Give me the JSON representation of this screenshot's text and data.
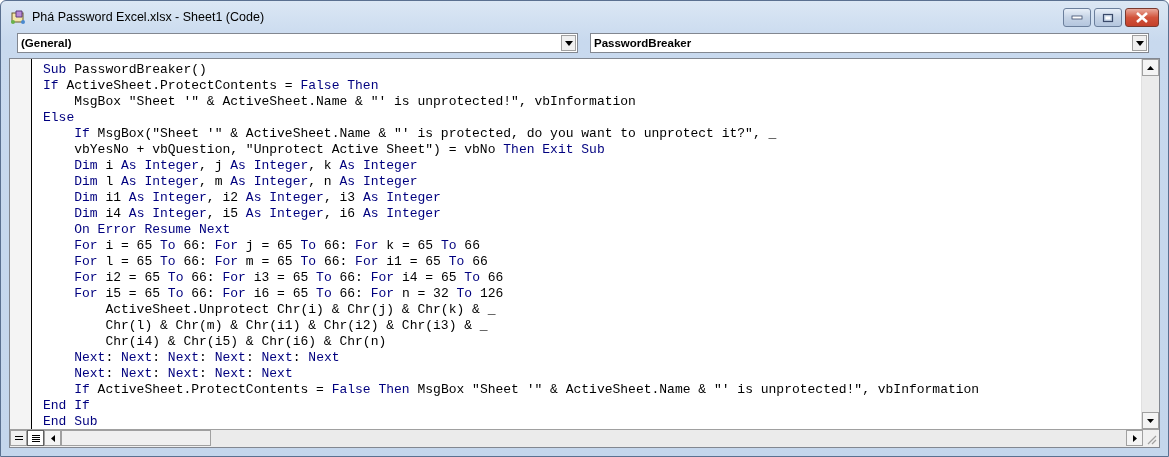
{
  "window": {
    "title": "Phá Password Excel.xlsx - Sheet1 (Code)"
  },
  "object_dropdown": {
    "value": "(General)"
  },
  "procedure_dropdown": {
    "value": "PasswordBreaker"
  },
  "code_lines": [
    {
      "tokens": [
        {
          "kind": "keyword",
          "text": "Sub"
        },
        {
          "kind": "plain",
          "text": " PasswordBreaker()"
        }
      ]
    },
    {
      "tokens": [
        {
          "kind": "keyword",
          "text": "If"
        },
        {
          "kind": "plain",
          "text": " ActiveSheet.ProtectContents = "
        },
        {
          "kind": "keyword",
          "text": "False Then"
        }
      ]
    },
    {
      "tokens": [
        {
          "kind": "plain",
          "text": "    MsgBox \"Sheet '\" & ActiveSheet.Name & \"' is unprotected!\", vbInformation"
        }
      ]
    },
    {
      "tokens": [
        {
          "kind": "keyword",
          "text": "Else"
        }
      ]
    },
    {
      "tokens": [
        {
          "kind": "keyword",
          "text": "    If"
        },
        {
          "kind": "plain",
          "text": " MsgBox(\"Sheet '\" & ActiveSheet.Name & \"' is protected, do you want to unprotect it?\", _"
        }
      ]
    },
    {
      "tokens": [
        {
          "kind": "plain",
          "text": "    vbYesNo + vbQuestion, \"Unprotect Active Sheet\") = vbNo "
        },
        {
          "kind": "keyword",
          "text": "Then Exit Sub"
        }
      ]
    },
    {
      "tokens": [
        {
          "kind": "keyword",
          "text": "    Dim"
        },
        {
          "kind": "plain",
          "text": " i "
        },
        {
          "kind": "keyword",
          "text": "As Integer"
        },
        {
          "kind": "plain",
          "text": ", j "
        },
        {
          "kind": "keyword",
          "text": "As Integer"
        },
        {
          "kind": "plain",
          "text": ", k "
        },
        {
          "kind": "keyword",
          "text": "As Integer"
        }
      ]
    },
    {
      "tokens": [
        {
          "kind": "keyword",
          "text": "    Dim"
        },
        {
          "kind": "plain",
          "text": " l "
        },
        {
          "kind": "keyword",
          "text": "As Integer"
        },
        {
          "kind": "plain",
          "text": ", m "
        },
        {
          "kind": "keyword",
          "text": "As Integer"
        },
        {
          "kind": "plain",
          "text": ", n "
        },
        {
          "kind": "keyword",
          "text": "As Integer"
        }
      ]
    },
    {
      "tokens": [
        {
          "kind": "keyword",
          "text": "    Dim"
        },
        {
          "kind": "plain",
          "text": " i1 "
        },
        {
          "kind": "keyword",
          "text": "As Integer"
        },
        {
          "kind": "plain",
          "text": ", i2 "
        },
        {
          "kind": "keyword",
          "text": "As Integer"
        },
        {
          "kind": "plain",
          "text": ", i3 "
        },
        {
          "kind": "keyword",
          "text": "As Integer"
        }
      ]
    },
    {
      "tokens": [
        {
          "kind": "keyword",
          "text": "    Dim"
        },
        {
          "kind": "plain",
          "text": " i4 "
        },
        {
          "kind": "keyword",
          "text": "As Integer"
        },
        {
          "kind": "plain",
          "text": ", i5 "
        },
        {
          "kind": "keyword",
          "text": "As Integer"
        },
        {
          "kind": "plain",
          "text": ", i6 "
        },
        {
          "kind": "keyword",
          "text": "As Integer"
        }
      ]
    },
    {
      "tokens": [
        {
          "kind": "keyword",
          "text": "    On Error Resume Next"
        }
      ]
    },
    {
      "tokens": [
        {
          "kind": "keyword",
          "text": "    For"
        },
        {
          "kind": "plain",
          "text": " i = 65 "
        },
        {
          "kind": "keyword",
          "text": "To"
        },
        {
          "kind": "plain",
          "text": " 66: "
        },
        {
          "kind": "keyword",
          "text": "For"
        },
        {
          "kind": "plain",
          "text": " j = 65 "
        },
        {
          "kind": "keyword",
          "text": "To"
        },
        {
          "kind": "plain",
          "text": " 66: "
        },
        {
          "kind": "keyword",
          "text": "For"
        },
        {
          "kind": "plain",
          "text": " k = 65 "
        },
        {
          "kind": "keyword",
          "text": "To"
        },
        {
          "kind": "plain",
          "text": " 66"
        }
      ]
    },
    {
      "tokens": [
        {
          "kind": "keyword",
          "text": "    For"
        },
        {
          "kind": "plain",
          "text": " l = 65 "
        },
        {
          "kind": "keyword",
          "text": "To"
        },
        {
          "kind": "plain",
          "text": " 66: "
        },
        {
          "kind": "keyword",
          "text": "For"
        },
        {
          "kind": "plain",
          "text": " m = 65 "
        },
        {
          "kind": "keyword",
          "text": "To"
        },
        {
          "kind": "plain",
          "text": " 66: "
        },
        {
          "kind": "keyword",
          "text": "For"
        },
        {
          "kind": "plain",
          "text": " i1 = 65 "
        },
        {
          "kind": "keyword",
          "text": "To"
        },
        {
          "kind": "plain",
          "text": " 66"
        }
      ]
    },
    {
      "tokens": [
        {
          "kind": "keyword",
          "text": "    For"
        },
        {
          "kind": "plain",
          "text": " i2 = 65 "
        },
        {
          "kind": "keyword",
          "text": "To"
        },
        {
          "kind": "plain",
          "text": " 66: "
        },
        {
          "kind": "keyword",
          "text": "For"
        },
        {
          "kind": "plain",
          "text": " i3 = 65 "
        },
        {
          "kind": "keyword",
          "text": "To"
        },
        {
          "kind": "plain",
          "text": " 66: "
        },
        {
          "kind": "keyword",
          "text": "For"
        },
        {
          "kind": "plain",
          "text": " i4 = 65 "
        },
        {
          "kind": "keyword",
          "text": "To"
        },
        {
          "kind": "plain",
          "text": " 66"
        }
      ]
    },
    {
      "tokens": [
        {
          "kind": "keyword",
          "text": "    For"
        },
        {
          "kind": "plain",
          "text": " i5 = 65 "
        },
        {
          "kind": "keyword",
          "text": "To"
        },
        {
          "kind": "plain",
          "text": " 66: "
        },
        {
          "kind": "keyword",
          "text": "For"
        },
        {
          "kind": "plain",
          "text": " i6 = 65 "
        },
        {
          "kind": "keyword",
          "text": "To"
        },
        {
          "kind": "plain",
          "text": " 66: "
        },
        {
          "kind": "keyword",
          "text": "For"
        },
        {
          "kind": "plain",
          "text": " n = 32 "
        },
        {
          "kind": "keyword",
          "text": "To"
        },
        {
          "kind": "plain",
          "text": " 126"
        }
      ]
    },
    {
      "tokens": [
        {
          "kind": "plain",
          "text": "        ActiveSheet.Unprotect Chr(i) & Chr(j) & Chr(k) & _"
        }
      ]
    },
    {
      "tokens": [
        {
          "kind": "plain",
          "text": "        Chr(l) & Chr(m) & Chr(i1) & Chr(i2) & Chr(i3) & _"
        }
      ]
    },
    {
      "tokens": [
        {
          "kind": "plain",
          "text": "        Chr(i4) & Chr(i5) & Chr(i6) & Chr(n)"
        }
      ]
    },
    {
      "tokens": [
        {
          "kind": "keyword",
          "text": "    Next"
        },
        {
          "kind": "plain",
          "text": ": "
        },
        {
          "kind": "keyword",
          "text": "Next"
        },
        {
          "kind": "plain",
          "text": ": "
        },
        {
          "kind": "keyword",
          "text": "Next"
        },
        {
          "kind": "plain",
          "text": ": "
        },
        {
          "kind": "keyword",
          "text": "Next"
        },
        {
          "kind": "plain",
          "text": ": "
        },
        {
          "kind": "keyword",
          "text": "Next"
        },
        {
          "kind": "plain",
          "text": ": "
        },
        {
          "kind": "keyword",
          "text": "Next"
        }
      ]
    },
    {
      "tokens": [
        {
          "kind": "keyword",
          "text": "    Next"
        },
        {
          "kind": "plain",
          "text": ": "
        },
        {
          "kind": "keyword",
          "text": "Next"
        },
        {
          "kind": "plain",
          "text": ": "
        },
        {
          "kind": "keyword",
          "text": "Next"
        },
        {
          "kind": "plain",
          "text": ": "
        },
        {
          "kind": "keyword",
          "text": "Next"
        },
        {
          "kind": "plain",
          "text": ": "
        },
        {
          "kind": "keyword",
          "text": "Next"
        }
      ]
    },
    {
      "tokens": [
        {
          "kind": "keyword",
          "text": "    If"
        },
        {
          "kind": "plain",
          "text": " ActiveSheet.ProtectContents = "
        },
        {
          "kind": "keyword",
          "text": "False Then"
        },
        {
          "kind": "plain",
          "text": " MsgBox \"Sheet '\" & ActiveSheet.Name & \"' is unprotected!\", vbInformation"
        }
      ]
    },
    {
      "tokens": [
        {
          "kind": "keyword",
          "text": "End If"
        }
      ]
    },
    {
      "tokens": [
        {
          "kind": "keyword",
          "text": "End Sub"
        }
      ]
    }
  ],
  "view_buttons": [
    {
      "kind": "procedure",
      "selected": false
    },
    {
      "kind": "module",
      "selected": true
    }
  ]
}
